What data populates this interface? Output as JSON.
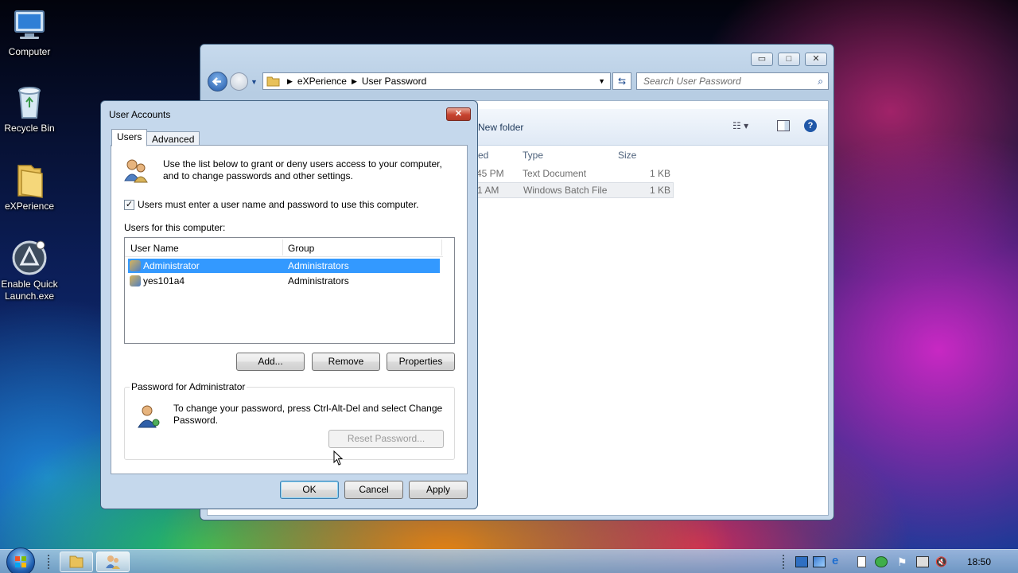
{
  "desktop": {
    "icons": [
      {
        "label": "Computer",
        "icon": "computer-icon"
      },
      {
        "label": "Recycle Bin",
        "icon": "recycle-bin-icon"
      },
      {
        "label": "eXPerience",
        "icon": "folder-icon"
      },
      {
        "label": "Enable Quick Launch.exe",
        "icon": "app-icon"
      }
    ]
  },
  "explorer": {
    "breadcrumb": [
      "eXPerience",
      "User Password"
    ],
    "search_placeholder": "Search User Password",
    "new_folder_label": "New folder",
    "columns": [
      "ed",
      "Type",
      "Size"
    ],
    "files": [
      {
        "date": "45 PM",
        "type": "Text Document",
        "size": "1 KB"
      },
      {
        "date": "1 AM",
        "type": "Windows Batch File",
        "size": "1 KB"
      }
    ]
  },
  "dialog": {
    "title": "User Accounts",
    "tabs": [
      "Users",
      "Advanced"
    ],
    "intro": "Use the list below to grant or deny users access to your computer, and to change passwords and other settings.",
    "checkbox_label": "Users must enter a user name and password to use this computer.",
    "checkbox_checked": true,
    "list_label": "Users for this computer:",
    "columns": [
      "User Name",
      "Group"
    ],
    "users": [
      {
        "name": "Administrator",
        "group": "Administrators",
        "selected": true
      },
      {
        "name": "yes101a4",
        "group": "Administrators",
        "selected": false
      }
    ],
    "buttons": {
      "add": "Add...",
      "remove": "Remove",
      "properties": "Properties",
      "reset": "Reset Password...",
      "ok": "OK",
      "cancel": "Cancel",
      "apply": "Apply"
    },
    "password_group_title": "Password for Administrator",
    "password_text": "To change your password, press Ctrl-Alt-Del and select Change Password."
  },
  "taskbar": {
    "clock": "18:50",
    "icons": [
      "start-orb-icon",
      "explorer-taskbar-icon",
      "user-accounts-taskbar-icon"
    ]
  },
  "colors": {
    "selection": "#3399ff",
    "accent": "#1e4b8f",
    "close_red": "#c7432f"
  }
}
